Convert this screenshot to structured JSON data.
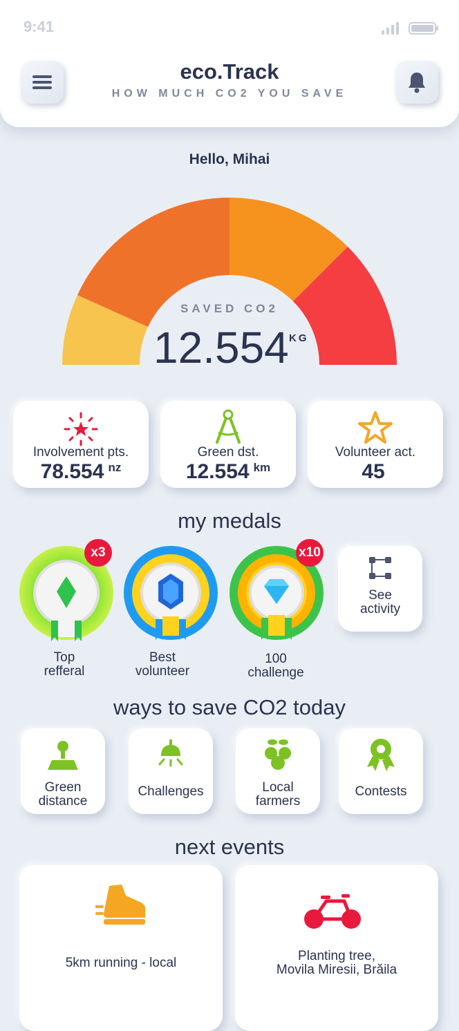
{
  "status": {
    "time": "9:41"
  },
  "header": {
    "title": "eco.Track",
    "subtitle": "HOW MUCH CO2 YOU SAVE"
  },
  "greeting": "Hello, Mihai",
  "gauge": {
    "label": "SAVED CO2",
    "value": "12.554",
    "unit": "KG",
    "segment_colors": [
      "#f7c44e",
      "#ef722b",
      "#f6921e",
      "#f43e42"
    ]
  },
  "stats": [
    {
      "icon": "sparkle-icon",
      "label": "Involvement pts.",
      "value": "78.554",
      "unit": "nz",
      "color": "#e8193c"
    },
    {
      "icon": "compass-icon",
      "label": "Green dst.",
      "value": "12.554",
      "unit": "km",
      "color": "#7cc223"
    },
    {
      "icon": "star-icon",
      "label": "Volunteer act.",
      "value": "45",
      "unit": "",
      "color": "#f5a623"
    }
  ],
  "medals_section": {
    "title": "my medals",
    "medals": [
      {
        "label_line1": "Top",
        "label_line2": "refferal",
        "badge": "x3"
      },
      {
        "label_line1": "Best",
        "label_line2": "volunteer",
        "badge": ""
      },
      {
        "label_line1": "100",
        "label_line2": "challenge",
        "badge": "x10"
      }
    ],
    "see_activity": {
      "line1": "See",
      "line2": "activity"
    }
  },
  "ways_section": {
    "title": "ways to save CO2 today",
    "items": [
      {
        "icon": "map-pin-icon",
        "line1": "Green",
        "line2": "distance"
      },
      {
        "icon": "lamp-icon",
        "line1": "Challenges",
        "line2": ""
      },
      {
        "icon": "fruit-icon",
        "line1": "Local",
        "line2": "farmers"
      },
      {
        "icon": "award-icon",
        "line1": "Contests",
        "line2": ""
      }
    ]
  },
  "events_section": {
    "title": "next events",
    "events": [
      {
        "icon": "running-shoe-icon",
        "line1": "5km running - local",
        "line2": ""
      },
      {
        "icon": "bicycle-icon",
        "line1": "Planting tree,",
        "line2": "Movila Miresii, Brăila"
      }
    ]
  }
}
